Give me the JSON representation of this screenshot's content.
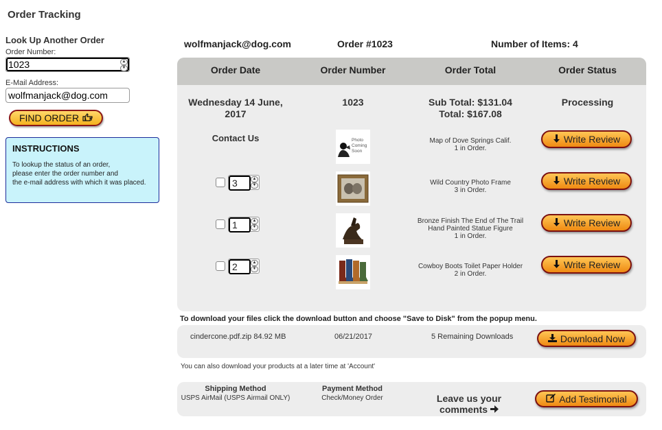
{
  "page": {
    "title": "Order Tracking"
  },
  "lookup": {
    "title": "Look Up Another Order",
    "order_number_label": "Order Number:",
    "order_number_value": "1023",
    "email_label": "E-Mail Address:",
    "email_value": "wolfmanjack@dog.com",
    "find_button": "FIND ORDER"
  },
  "instructions": {
    "title": "INSTRUCTIONS",
    "line1": "To lookup the status of an order,",
    "line2": "please enter the order number and",
    "line3": "the e-mail address with which it was placed."
  },
  "summary": {
    "email": "wolfmanjack@dog.com",
    "order": "Order #1023",
    "items": "Number of Items: 4"
  },
  "table": {
    "headers": [
      "Order Date",
      "Order Number",
      "Order Total",
      "Order Status"
    ],
    "date_line1": "Wednesday 14 June,",
    "date_line2": "2017",
    "number": "1023",
    "subtotal": "Sub Total: $131.04",
    "total": "Total: $167.08",
    "status": "Processing",
    "contact": "Contact Us",
    "review_button": "Write Review",
    "items": [
      {
        "line1": "Map of Dove Springs Calif.",
        "line2": "1 in Order.",
        "qty": "",
        "thumb": "photo-coming-soon",
        "photo_text": [
          "Photo",
          "Coming",
          "Soon"
        ]
      },
      {
        "line1": "Wild Country Photo Frame",
        "line2": "3 in Order.",
        "qty": "3",
        "thumb": "photo-frame"
      },
      {
        "line1": "Bronze Finish The End of The Trail",
        "line1b": "Hand Painted Statue Figure",
        "line2": "1 in Order.",
        "qty": "1",
        "thumb": "statue"
      },
      {
        "line1": "Cowboy Boots Toilet Paper Holder",
        "line2": "2 in Order.",
        "qty": "2",
        "thumb": "boots"
      }
    ]
  },
  "download": {
    "note": "To download your files click the download button and choose \"Save to Disk\" from the popup menu.",
    "file": "cindercone.pdf.zip 84.92 MB",
    "date": "06/21/2017",
    "remaining": "5 Remaining Downloads",
    "button": "Download Now",
    "later": "You can also download your products at a later time at 'Account'"
  },
  "shipping": {
    "method_label": "Shipping Method",
    "method_value": "USPS AirMail (USPS Airmail ONLY)",
    "payment_label": "Payment Method",
    "payment_value": "Check/Money Order",
    "leave_line1": "Leave us your",
    "leave_line2": "comments",
    "testimonial_button": "Add Testimonial"
  }
}
